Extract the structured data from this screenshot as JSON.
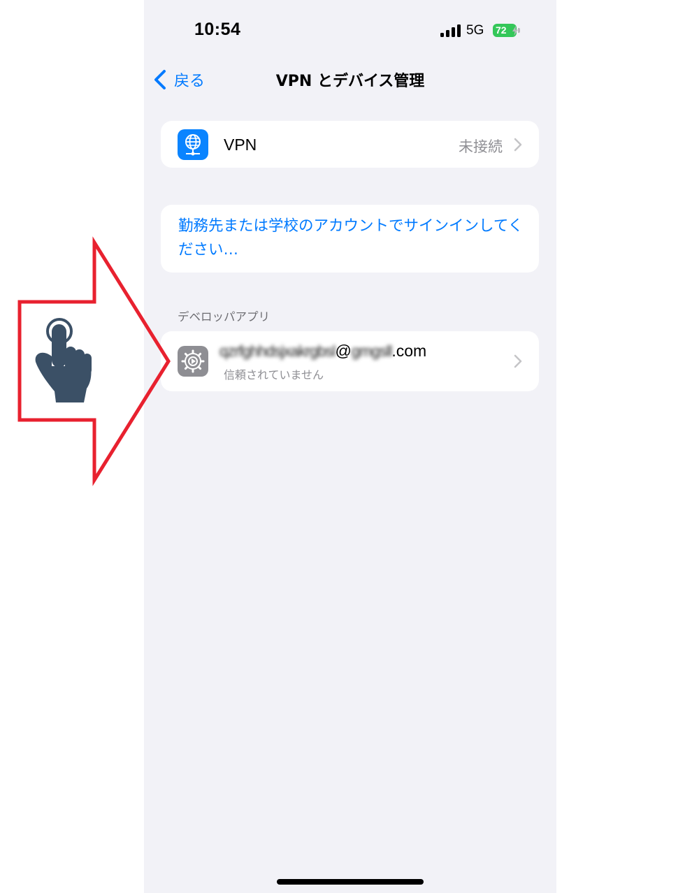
{
  "status_bar": {
    "time": "10:54",
    "network": "5G",
    "battery": "72"
  },
  "nav": {
    "back_label": "戻る",
    "title": "VPN とデバイス管理"
  },
  "vpn_row": {
    "label": "VPN",
    "status": "未接続",
    "icon": "globe-network-icon"
  },
  "signin": {
    "text": "勤務先または学校のアカウントでサインインしてください…"
  },
  "developer_section": {
    "header": "デベロッパアプリ",
    "email_blurred": "qzrfghhdsjxakrgbsl",
    "email_at": "@",
    "email_domain_blurred": "gmgsll",
    "email_tld": ".com",
    "subtitle": "信頼されていません",
    "icon": "gear-icon"
  },
  "overlay": {
    "icon": "tap-hand-icon",
    "arrow": "right-arrow-annotation",
    "arrow_color": "#e8212f",
    "hand_color": "#3b5066"
  },
  "colors": {
    "accent": "#007aff",
    "background": "#f2f2f7",
    "battery": "#34c759",
    "secondary_text": "#8e8e93"
  }
}
